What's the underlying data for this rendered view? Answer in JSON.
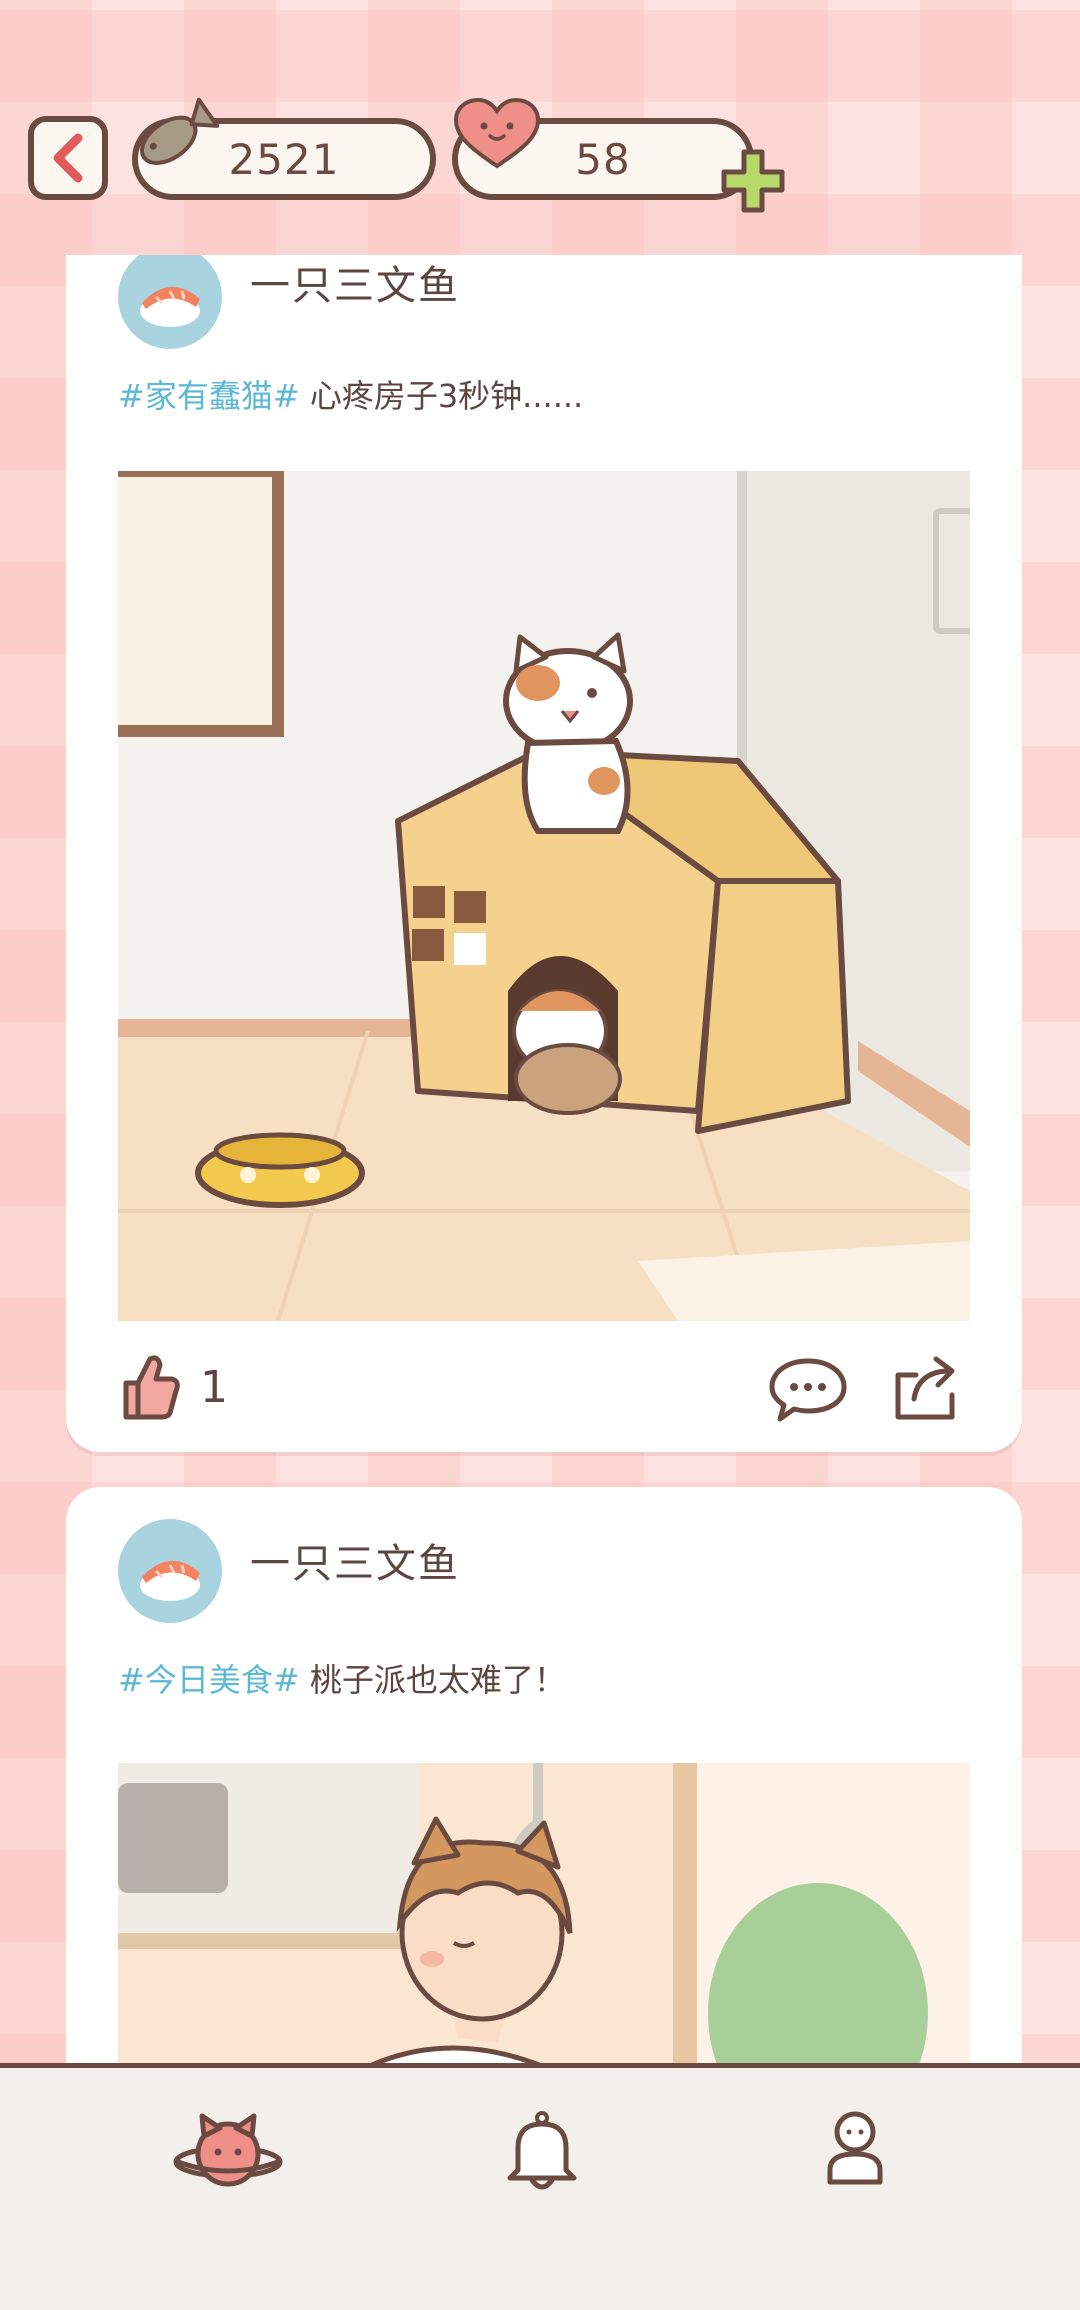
{
  "header": {
    "fish_count": "2521",
    "heart_count": "58",
    "icons": [
      "back-chevron-icon",
      "fish-icon",
      "heart-face-icon",
      "plus-icon"
    ]
  },
  "feed": {
    "posts": [
      {
        "author": "一只三文鱼",
        "tag": "#家有蠢猫#",
        "text": " 心疼房子3秒钟......",
        "likes": "1",
        "image_subject": "cats-in-cardboard-house"
      },
      {
        "author": "一只三文鱼",
        "tag": "#今日美食#",
        "text": " 桃子派也太难了！",
        "image_subject": "cat-eared-boy-kitchen"
      }
    ]
  },
  "colors": {
    "accent_tag": "#5cb8d4",
    "text": "#5d4540",
    "outline": "#6b4a41",
    "like": "#f3a7a1",
    "plus": "#b6d96a"
  },
  "bottom_nav": {
    "items": [
      "home-cat-planet-icon",
      "bell-icon",
      "profile-icon"
    ]
  }
}
